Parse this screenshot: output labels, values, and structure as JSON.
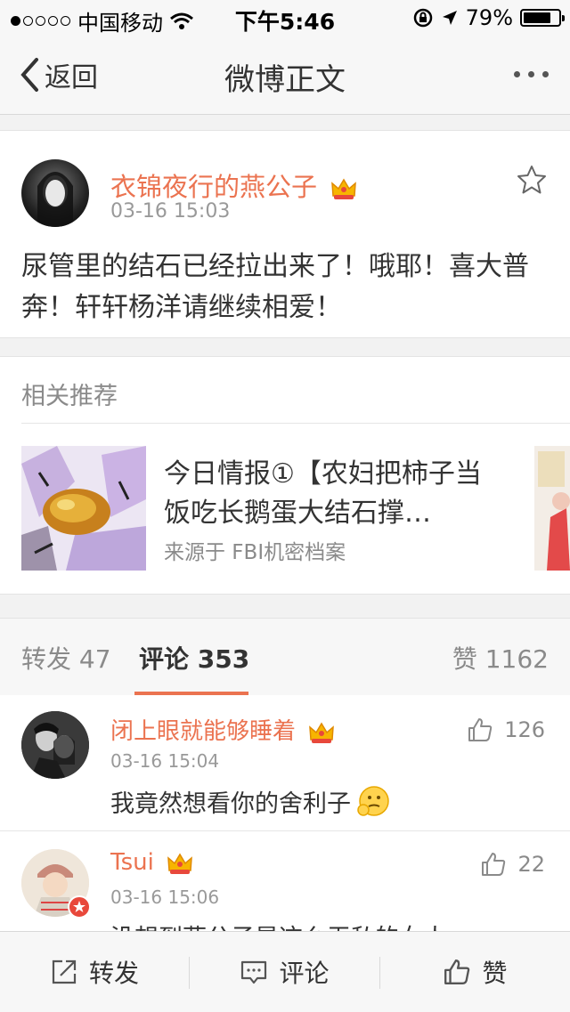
{
  "status": {
    "carrier": "中国移动",
    "time": "下午5:46",
    "battery": "79%",
    "battery_level": 0.79
  },
  "nav": {
    "back_label": "返回",
    "title": "微博正文",
    "more_icon": "more-icon"
  },
  "post": {
    "author": "衣锦夜行的燕公子",
    "time": "03-16 15:03",
    "text": "尿管里的结石已经拉出来了！哦耶！喜大普奔！轩轩杨洋请继续相爱！"
  },
  "recommend": {
    "label": "相关推荐",
    "title": "今日情报①【农妇把柿子当饭吃长鹅蛋大结石撑…",
    "source": "来源于 FBI机密档案"
  },
  "tabs": {
    "repost": "转发 47",
    "comment": "评论 353",
    "like": "赞 1162"
  },
  "comments": [
    {
      "name": "闭上眼就能够睡着",
      "time": "03-16 15:04",
      "likes": "126",
      "text": "我竟然想看你的舍利子"
    },
    {
      "name": "Tsui",
      "time": "03-16 15:06",
      "likes": "22",
      "text": "没想到燕公子是这么无私的女人"
    }
  ],
  "toolbar": {
    "repost": "转发",
    "comment": "评论",
    "like": "赞"
  },
  "colors": {
    "accent": "#eb7350",
    "gray": "#8a8a8a"
  }
}
